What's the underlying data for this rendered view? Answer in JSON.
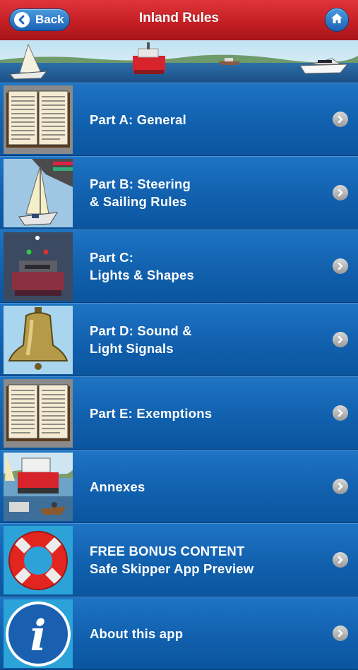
{
  "header": {
    "back_label": "Back",
    "title": "Inland Rules",
    "home_icon": "home-icon"
  },
  "banner": {
    "scene": "boats-on-water"
  },
  "menu": {
    "items": [
      {
        "line1": "Part A: General",
        "line2": "",
        "icon": "book-icon"
      },
      {
        "line1": "Part B: Steering",
        "line2": "& Sailing Rules",
        "icon": "sailboat-icon"
      },
      {
        "line1": "Part C:",
        "line2": "Lights & Shapes",
        "icon": "vessel-lights-icon"
      },
      {
        "line1": "Part D: Sound &",
        "line2": "Light Signals",
        "icon": "bell-icon"
      },
      {
        "line1": "Part E: Exemptions",
        "line2": "",
        "icon": "book-icon"
      },
      {
        "line1": "Annexes",
        "line2": "",
        "icon": "harbor-icon"
      },
      {
        "line1": "FREE BONUS CONTENT",
        "line2": "Safe Skipper App Preview",
        "icon": "life-ring-icon"
      },
      {
        "line1": "About this app",
        "line2": "",
        "icon": "info-icon"
      }
    ]
  }
}
